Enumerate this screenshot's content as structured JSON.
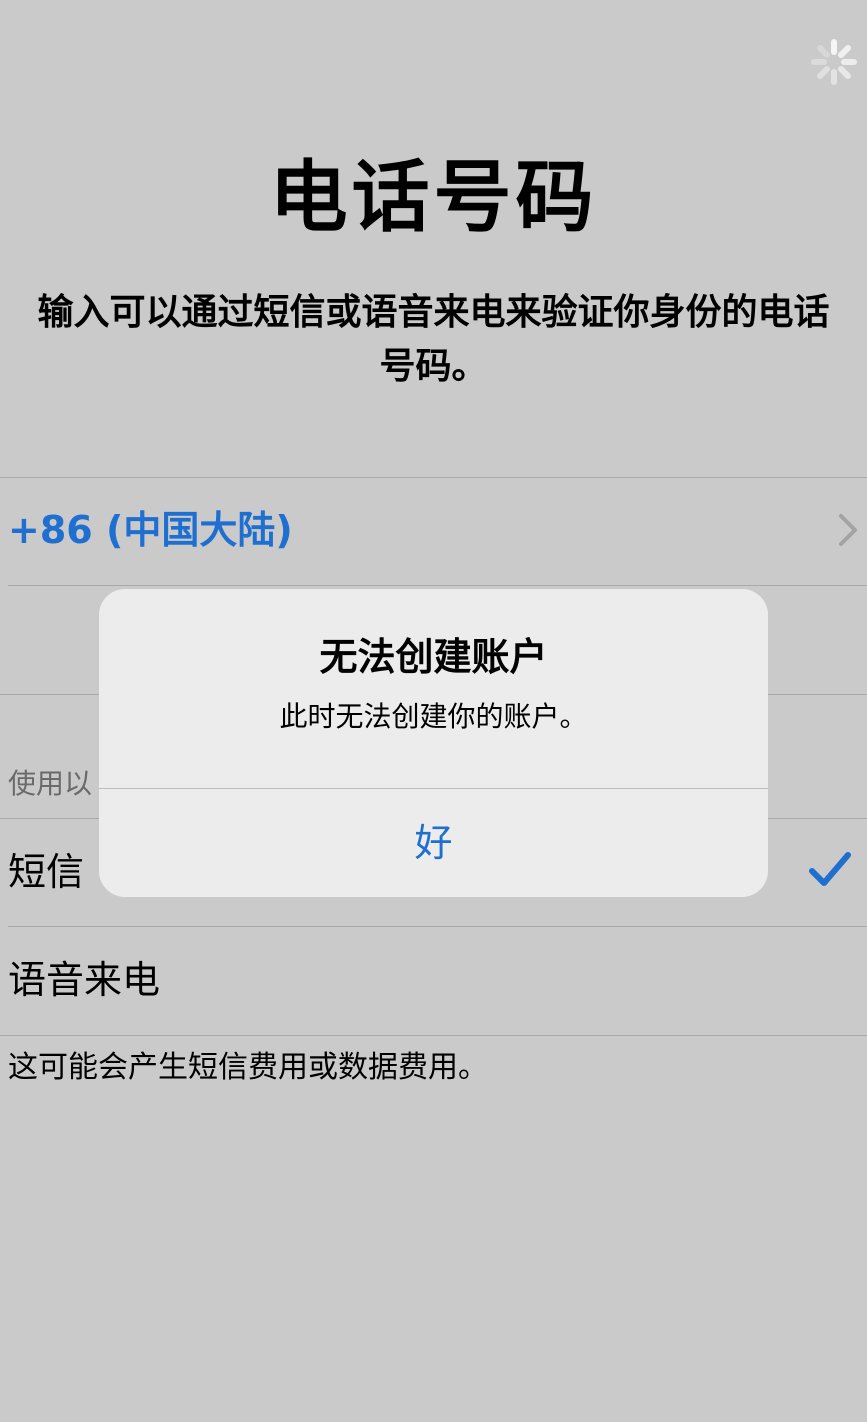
{
  "icons": {
    "spinner": "loading-spinner-icon",
    "chevron": "chevron-right-icon",
    "check": "checkmark-icon"
  },
  "colors": {
    "background": "#cacaca",
    "accent": "#1e6fd0",
    "alert_background": "#ececec"
  },
  "page": {
    "title": "电话号码",
    "subtitle": "输入可以通过短信或语音来电来验证你身份的电话号码。"
  },
  "country": {
    "label": "+86 (中国大陆)"
  },
  "verification": {
    "section_header": "使用以",
    "options": [
      {
        "label": "短信",
        "selected": true
      },
      {
        "label": "语音来电",
        "selected": false
      }
    ],
    "footnote": "这可能会产生短信费用或数据费用。"
  },
  "alert": {
    "title": "无法创建账户",
    "message": "此时无法创建你的账户。",
    "ok_label": "好"
  }
}
